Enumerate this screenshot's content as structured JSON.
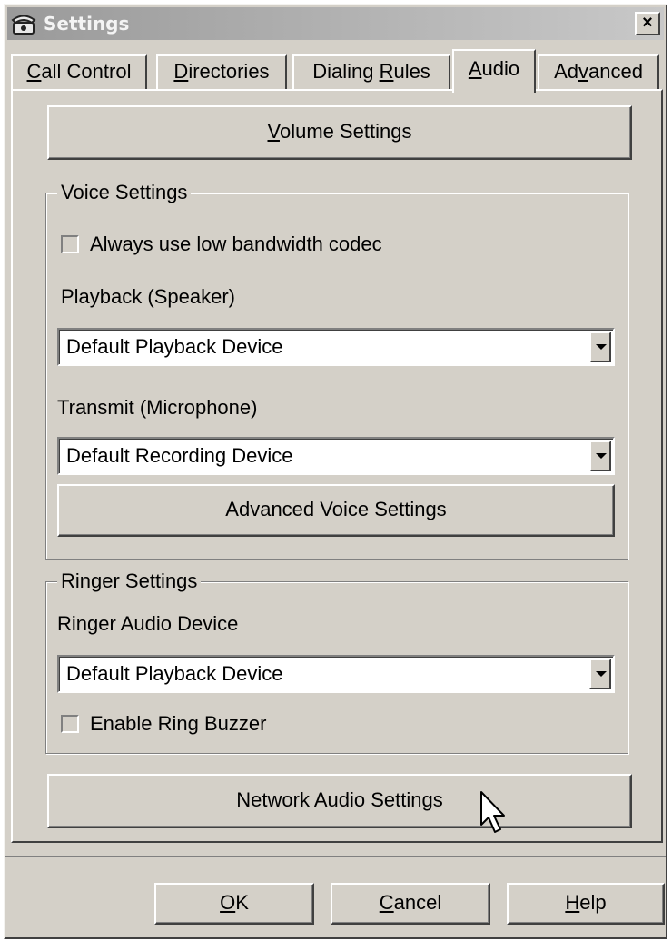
{
  "window": {
    "title": "Settings",
    "close_label": "×"
  },
  "tabs": [
    {
      "label": "Call Control",
      "mnemonic": "C",
      "rest": "all Control",
      "active": false
    },
    {
      "label": "Directories",
      "mnemonic": "D",
      "rest": "irectories",
      "active": false
    },
    {
      "label": "Dialing Rules",
      "pre": "Dialing ",
      "mnemonic": "R",
      "rest": "ules",
      "active": false
    },
    {
      "label": "Audio",
      "mnemonic": "A",
      "rest": "udio",
      "active": true
    },
    {
      "label": "Advanced",
      "pre": "Ad",
      "mnemonic": "v",
      "rest": "anced",
      "active": false
    }
  ],
  "audio_tab": {
    "volume_button": {
      "mnemonic": "V",
      "rest": "olume Settings"
    },
    "voice_settings": {
      "legend": "Voice Settings",
      "low_bandwidth_label": "Always use low bandwidth codec",
      "low_bandwidth_checked": false,
      "playback_label": "Playback (Speaker)",
      "playback_value": "Default Playback Device",
      "transmit_label": "Transmit (Microphone)",
      "transmit_value": "Default Recording Device",
      "advanced_button": "Advanced Voice Settings"
    },
    "ringer_settings": {
      "legend": "Ringer Settings",
      "device_label": "Ringer Audio Device",
      "device_value": "Default Playback Device",
      "buzzer_label": "Enable Ring Buzzer",
      "buzzer_checked": false
    },
    "network_button": "Network Audio Settings"
  },
  "footer": {
    "ok": {
      "mnemonic": "O",
      "rest": "K"
    },
    "cancel": {
      "mnemonic": "C",
      "rest": "ancel"
    },
    "help": {
      "mnemonic": "H",
      "rest": "elp"
    }
  },
  "colors": {
    "face": "#d4d0c8",
    "highlight": "#ffffff",
    "shadow": "#808080",
    "dark_shadow": "#404040",
    "title_gradient_start": "#9a9a9a"
  }
}
